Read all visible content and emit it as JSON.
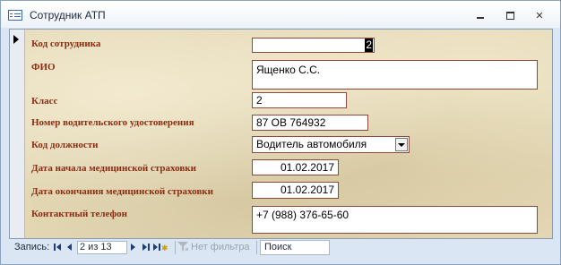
{
  "window": {
    "title": "Сотрудник АТП",
    "minimize_glyph": "‒",
    "close_glyph": "✕"
  },
  "form": {
    "fields": [
      {
        "label": "Код сотрудника",
        "value": "2"
      },
      {
        "label": "ФИО",
        "value": "Ященко С.С."
      },
      {
        "label": "Класс",
        "value": "2"
      },
      {
        "label": "Номер водительского удостоверения",
        "value": "87 ОВ 764932"
      },
      {
        "label": "Код должности",
        "value": "Водитель автомобиля"
      },
      {
        "label": "Дата начала медицинской страховки",
        "value": "01.02.2017"
      },
      {
        "label": "Дата окончания медицинской страховки",
        "value": "01.02.2017"
      },
      {
        "label": "Контактный телефон",
        "value": "+7 (988) 376-65-60"
      }
    ]
  },
  "navigation": {
    "label": "Запись:",
    "position": "2 из 13",
    "new_record_glyph": "✱",
    "filter": "Нет фильтра",
    "search": "Поиск"
  },
  "icons": {
    "app": "form-icon",
    "minimize": "minimize-icon",
    "maximize": "maximize-icon",
    "close": "close-icon",
    "record_selector": "current-record-arrow-icon",
    "dropdown": "chevron-down-icon",
    "filter": "filter-icon"
  },
  "colors": {
    "label_text": "#8b2d12",
    "field_border": "#8b4a3a",
    "form_background": "#e3d7b4",
    "window_frame": "#dbe6f4"
  }
}
